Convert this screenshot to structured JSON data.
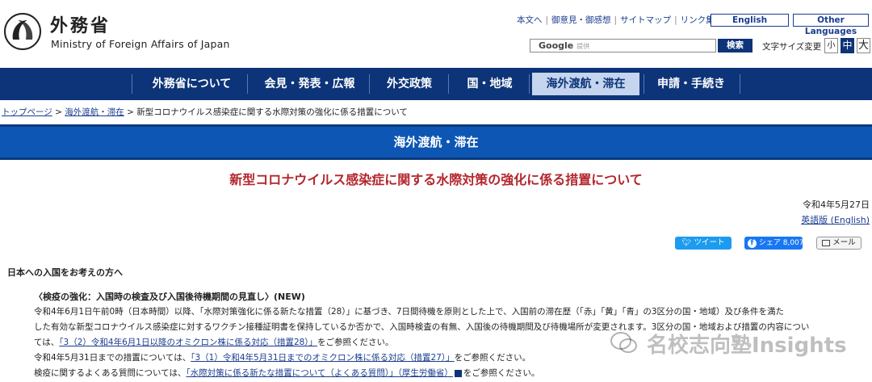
{
  "header": {
    "logo_title": "外務省",
    "logo_subtitle": "Ministry of Foreign Affairs of Japan",
    "util_links": [
      "本文へ",
      "御意見・御感想",
      "サイトマップ",
      "リンク集"
    ],
    "lang_english": "English",
    "lang_other": "Other Languages",
    "search_brand": "Google",
    "search_suffix": "提供",
    "search_button": "検索",
    "fontsize_label": "文字サイズ変更",
    "fontsize_small": "小",
    "fontsize_mid": "中",
    "fontsize_large": "大"
  },
  "nav": {
    "items": [
      {
        "label": "外務省について"
      },
      {
        "label": "会見・発表・広報"
      },
      {
        "label": "外交政策"
      },
      {
        "label": "国・地域"
      },
      {
        "label": "海外渡航・滞在"
      },
      {
        "label": "申請・手続き"
      }
    ],
    "active_index": 4
  },
  "breadcrumb": {
    "home": "トップページ",
    "section": "海外渡航・滞在",
    "current": "新型コロナウイルス感染症に関する水際対策の強化に係る措置について",
    "sep": " > "
  },
  "section_title": "海外渡航・滞在",
  "page_title": "新型コロナウイルス感染症に関する水際対策の強化に係る措置について",
  "date": "令和4年5月27日",
  "english_link": "英語版 (English)",
  "share": {
    "tweet": "ツイート",
    "fb": "シェア 8,007",
    "mail": "メール"
  },
  "content": {
    "subhead": "日本への入国をお考えの方へ",
    "subhead2": "〈検疫の強化：入国時の検査及び入国後待機期間の見直し〉(NEW)",
    "p1": "令和4年6月1日午前0時（日本時間）以降、「水際対策強化に係る新たな措置（28）」に基づき、7日間待機を原則とした上で、入国前の滞在歴（「赤」「黄」「青」の3区分の国・地域）及び条件を満た",
    "p2": "した有効な新型コロナウイルス感染症に対するワクチン接種証明書を保持しているか否かで、入国時検査の有無、入国後の待機期間及び待機場所が変更されます。3区分の国・地域および措置の内容につい",
    "p3_pre": "ては、",
    "p3_link": "「3（2）令和4年6月1日以降のオミクロン株に係る対応（措置28）」",
    "p3_post": "をご参照ください。",
    "p4_pre": "令和4年5月31日までの措置については、",
    "p4_link": "「3（1）令和4年5月31日までのオミクロン株に係る対応（措置27）」",
    "p4_post": "をご参照ください。",
    "p5_pre": "検疫に関するよくある質問については、",
    "p5_link": "「水際対策に係る新たな措置について（よくある質問）」（厚生労働省）",
    "p5_post": "をご参照ください。"
  },
  "watermark": "名校志向塾Insights"
}
